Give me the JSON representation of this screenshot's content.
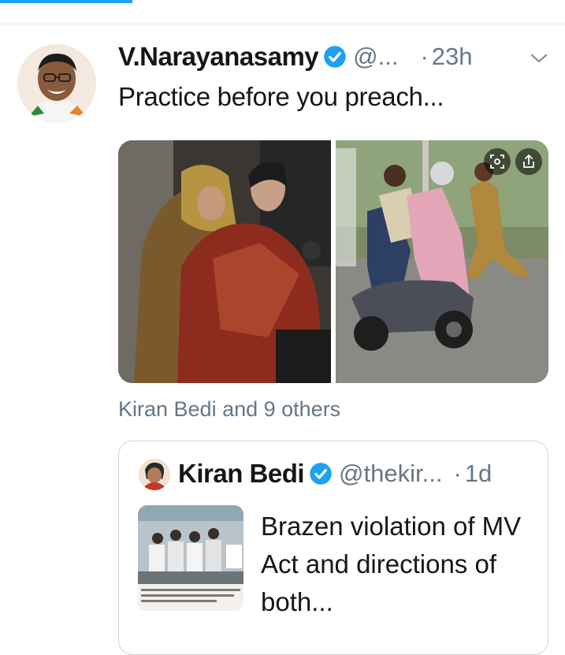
{
  "tweet": {
    "author_name": "V.Narayanasamy",
    "handle": "@...",
    "separator": "·",
    "time": "23h",
    "text": "Practice before you preach...",
    "liked_by": "Kiran Bedi and 9 others"
  },
  "quoted_tweet": {
    "author_name": "Kiran Bedi",
    "handle": "@thekir...",
    "separator": "·",
    "time": "1d",
    "text": "Brazen violation of MV Act and directions of both..."
  },
  "icons": {
    "verified": "verified-badge-icon",
    "caret": "chevron-down-icon",
    "media_search": "visual-search-icon",
    "media_share": "share-icon"
  },
  "colors": {
    "accent": "#1da1f2",
    "secondary_text": "#657786",
    "primary_text": "#14171a",
    "border": "#ccd6dd"
  }
}
